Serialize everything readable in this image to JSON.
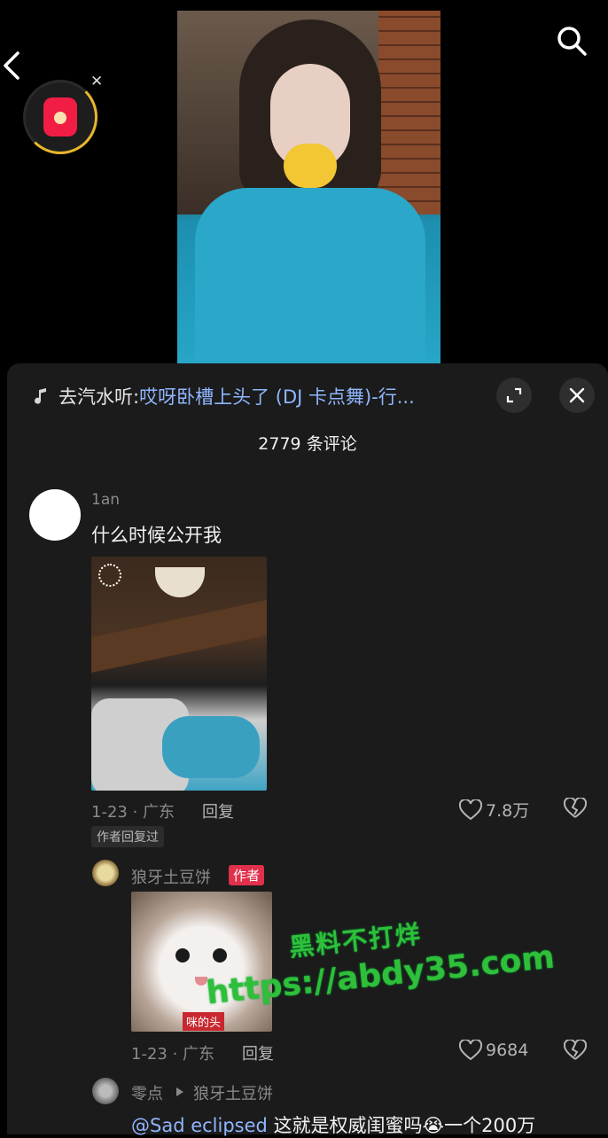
{
  "music": {
    "lead": "去汽水听:",
    "song": "哎呀卧槽上头了 (DJ 卡点舞)-行..."
  },
  "comments_count": "2779 条评论",
  "comment1": {
    "user": "1an",
    "text": "什么时候公开我",
    "meta": "1-23 · 广东",
    "reply": "回复",
    "likes": "7.8万",
    "author_replied": "作者回复过"
  },
  "reply1": {
    "user": "狼牙土豆饼",
    "author_badge": "作者",
    "image_caption": "咪的头",
    "meta": "1-23 · 广东",
    "reply": "回复",
    "likes": "9684"
  },
  "reply2": {
    "user": "零点",
    "target": "狼牙土豆饼",
    "mention": "@Sad eclipsed",
    "text": "这就是权威闺蜜吗😭一个200万"
  },
  "watermark": {
    "line1": "黑料不打烊",
    "line2": "https://abdy35.com"
  },
  "colors": {
    "link": "#8fb6ff",
    "author_badge": "#e0304b",
    "watermark": "#2fbf3a",
    "redpacket": "#f21d45"
  }
}
